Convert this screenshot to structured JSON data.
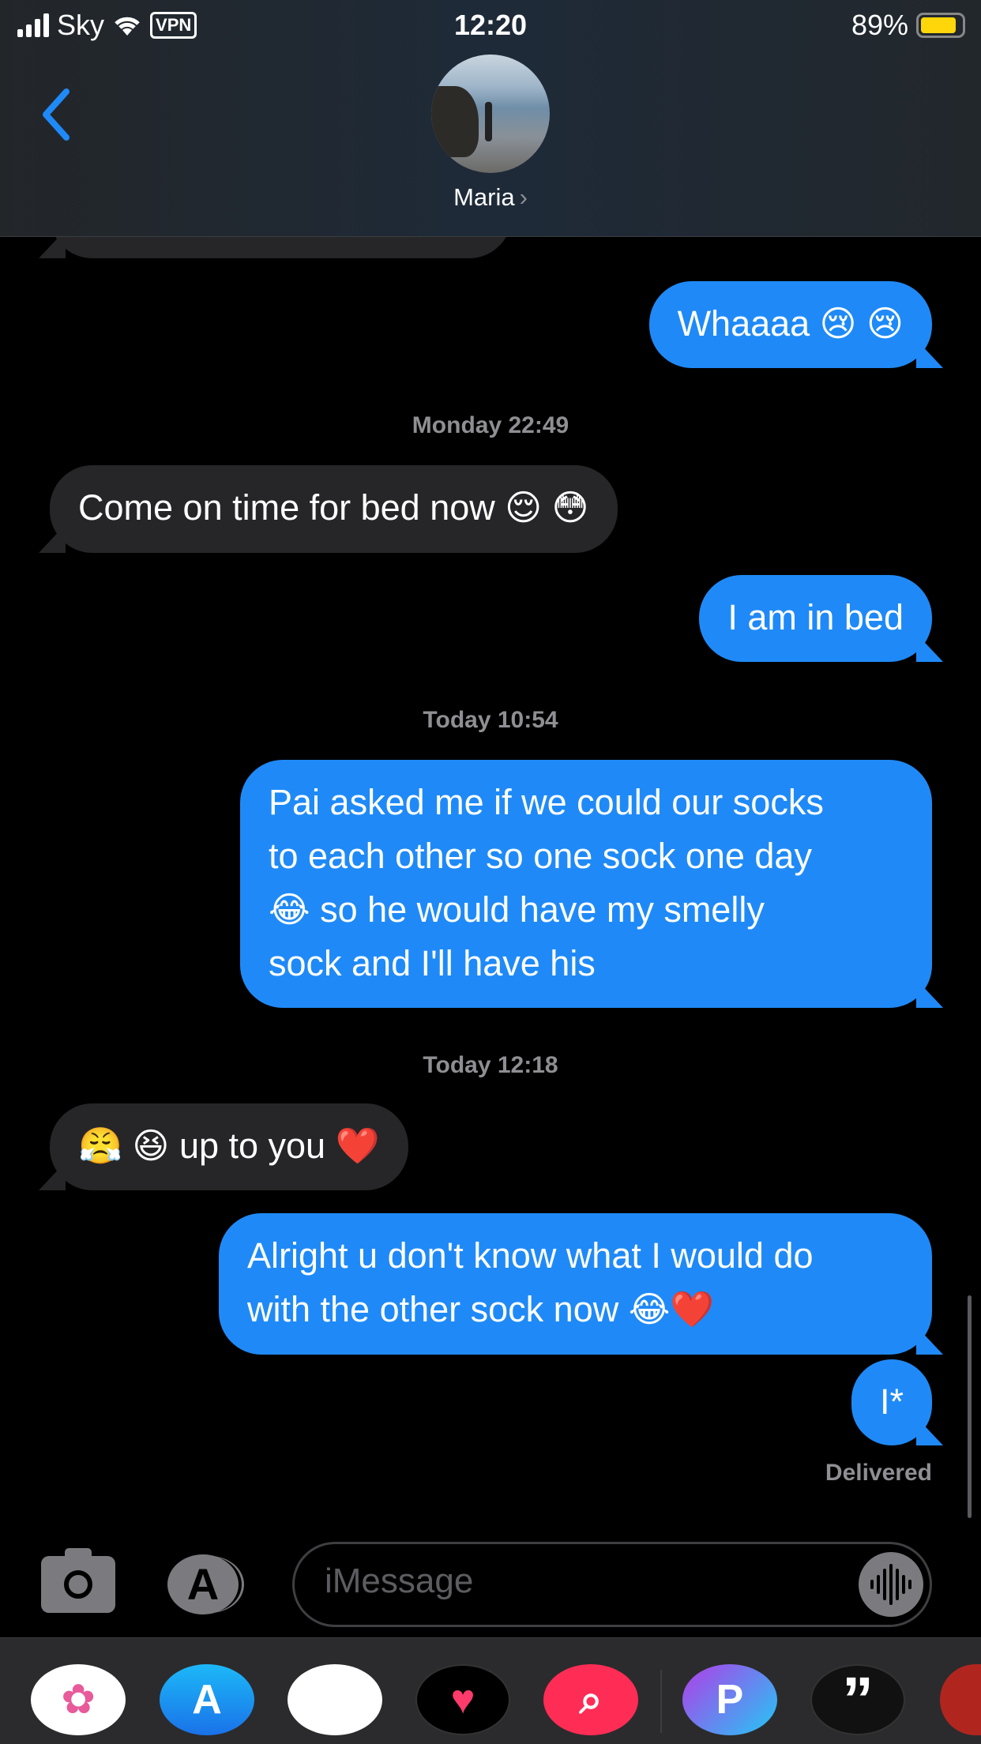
{
  "status_bar": {
    "carrier": "Sky",
    "vpn": "VPN",
    "time": "12:20",
    "battery": "89%",
    "battery_level": 0.89,
    "battery_color": "#ffd60a"
  },
  "header": {
    "contact_name": "Maria",
    "chevron": "›",
    "back_icon": "chevron-left-icon",
    "accent": "#1f8af7"
  },
  "messages": [
    {
      "type": "timestamp",
      "text": "Monday 22:49"
    },
    {
      "type": "bubble",
      "direction": "outgoing",
      "text": "Whaaaa 😢 😢"
    },
    {
      "type": "bubble",
      "direction": "incoming",
      "text": "Come on time for bed now 😌 😳"
    },
    {
      "type": "bubble",
      "direction": "outgoing",
      "text": "I am in bed"
    },
    {
      "type": "timestamp",
      "text": "Today 10:54"
    },
    {
      "type": "bubble",
      "direction": "outgoing",
      "lines": [
        "Pai asked me if we could our socks",
        "to each other so one sock one day",
        "😂 so he would have my smelly",
        "sock and I'll have his"
      ]
    },
    {
      "type": "timestamp",
      "text": "Today 12:18"
    },
    {
      "type": "bubble",
      "direction": "incoming",
      "text": "😤 😆 up to you ❤️"
    },
    {
      "type": "bubble",
      "direction": "outgoing",
      "lines": [
        "Alright u don't know what I would do",
        "with the other sock now 😂❤️"
      ]
    },
    {
      "type": "bubble",
      "direction": "outgoing",
      "text": "I*"
    }
  ],
  "delivery_status": "Delivered",
  "composer": {
    "placeholder": "iMessage",
    "value": ""
  },
  "app_drawer": [
    {
      "name": "photos",
      "glyph": "✿"
    },
    {
      "name": "app-store",
      "glyph": "A"
    },
    {
      "name": "memoji",
      "glyph": "😍"
    },
    {
      "name": "heart-app",
      "glyph": "♥"
    },
    {
      "name": "image-search",
      "glyph": "⌕"
    },
    {
      "name": "picsart",
      "glyph": "P"
    },
    {
      "name": "quotes",
      "glyph": "”"
    },
    {
      "name": "partial-app",
      "glyph": ""
    }
  ],
  "colors": {
    "outgoing_bubble": "#1f8af7",
    "incoming_bubble": "#262628",
    "timestamp": "#8e8e93"
  }
}
